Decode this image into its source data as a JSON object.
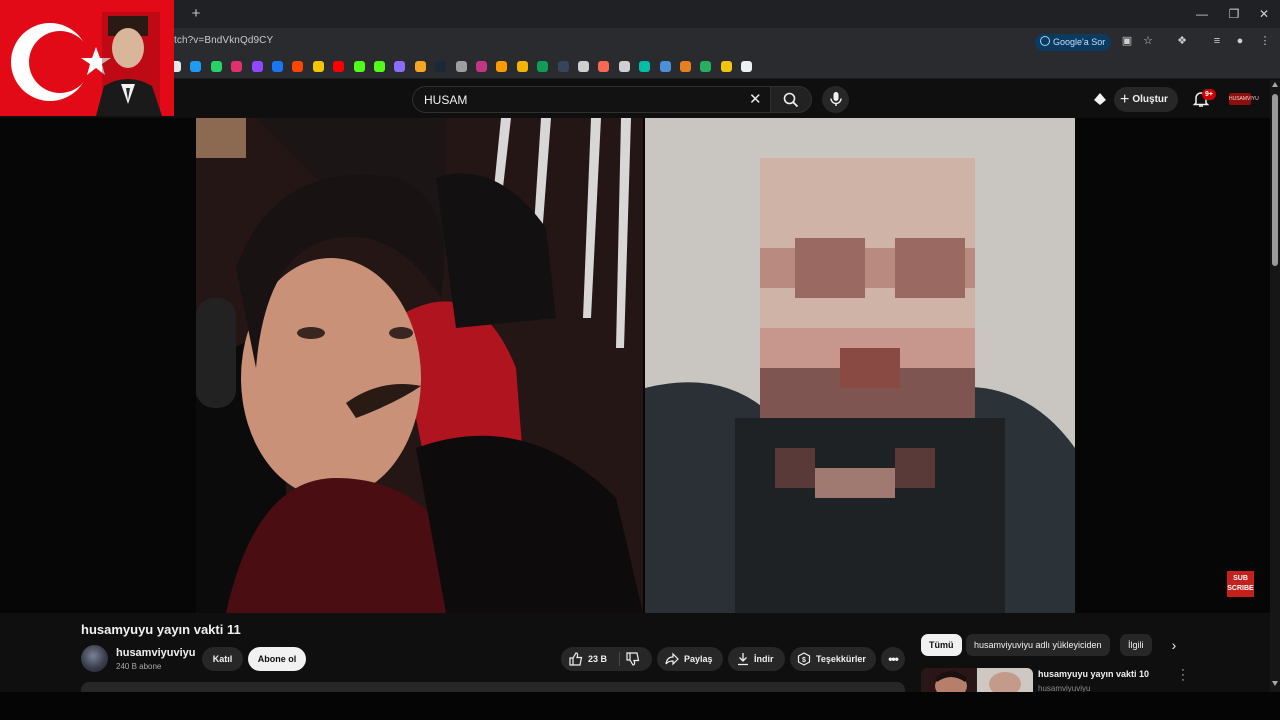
{
  "browser": {
    "new_tab_label": "+",
    "url": "tch?v=BndVknQd9CY",
    "google_sor_label": "Google'a Sor",
    "window_controls": [
      "minimize-icon",
      "restore-icon",
      "close-icon"
    ]
  },
  "bookmarks": {
    "icons": [
      "tiktok-icon",
      "bluesky-icon",
      "whatsapp-icon",
      "instagram-icon",
      "twitch-icon",
      "arrow-icon",
      "reddit-icon",
      "pmd-icon",
      "youtube-icon",
      "kick-icon",
      "kick-icon",
      "proton-icon",
      "clipboard-icon",
      "steam-icon",
      "list-icon",
      "rhythm-icon",
      "amazon-icon",
      "notes-icon",
      "sheet-icon",
      "tumblr-icon",
      "server-icon",
      "patreon-icon",
      "github-icon",
      "fandom-icon",
      "folder-icon",
      "paw-icon",
      "plus-icon",
      "layers-icon",
      "diamond-icon"
    ],
    "colors": [
      "#e8e8e8",
      "#1d9bf0",
      "#25d366",
      "#e1306c",
      "#9146ff",
      "#1877f2",
      "#ff4500",
      "#f2c500",
      "#ff0000",
      "#53fc18",
      "#53fc18",
      "#8a6cff",
      "#f5a623",
      "#1b2838",
      "#9e9e9e",
      "#c13584",
      "#ff9900",
      "#f4b400",
      "#0f9d58",
      "#35465c",
      "#cfcfcf",
      "#f96854",
      "#d0d0d0",
      "#00bfa5",
      "#4a90d9",
      "#e67e22",
      "#27ae60",
      "#f1c40f",
      "#ecf0f1"
    ]
  },
  "youtube_header": {
    "search_value": "HUSAM",
    "create_label": "Oluştur",
    "notification_count": "9+",
    "account_label": "HUSAMVIYU"
  },
  "video": {
    "subscribe_overlay_line1": "SUB",
    "subscribe_overlay_line2": "SCRIBE"
  },
  "video_info": {
    "title": "husamyuyu yayın vakti 11",
    "channel_name": "husamviyuviyu",
    "subscriber_count": "240 B abone",
    "join_label": "Katıl",
    "subscribe_label": "Abone ol",
    "like_count": "23 B",
    "share_label": "Paylaş",
    "download_label": "İndir",
    "thanks_label": "Teşekkürler",
    "more_label": "•••"
  },
  "sidebar": {
    "chips": [
      "Tümü",
      "husamviyuviyu adlı yükleyiciden",
      "İlgili"
    ],
    "recommendation": {
      "title": "husamyuyu yayın vakti 10",
      "channel": "husamviyuviyu"
    }
  },
  "colors": {
    "youtube_bg": "#0f0f0f",
    "flag_red": "#e30a17",
    "subscribe_bg": "#f1f1f1",
    "notification_red": "#cc0000"
  }
}
